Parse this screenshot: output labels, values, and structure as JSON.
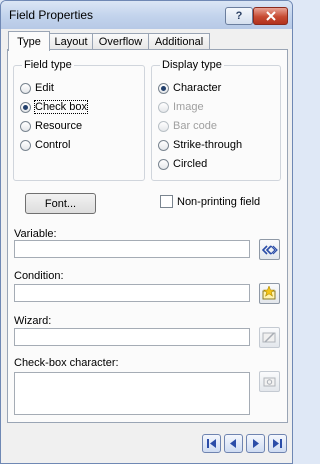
{
  "window": {
    "title": "Field Properties"
  },
  "tabs": [
    {
      "label": "Type",
      "active": true
    },
    {
      "label": "Layout",
      "active": false
    },
    {
      "label": "Overflow",
      "active": false
    },
    {
      "label": "Additional",
      "active": false
    }
  ],
  "field_type": {
    "title": "Field type",
    "options": [
      {
        "label": "Edit",
        "selected": false
      },
      {
        "label": "Check box",
        "selected": true
      },
      {
        "label": "Resource",
        "selected": false
      },
      {
        "label": "Control",
        "selected": false
      }
    ]
  },
  "display_type": {
    "title": "Display type",
    "options": [
      {
        "label": "Character",
        "selected": true,
        "enabled": true
      },
      {
        "label": "Image",
        "selected": false,
        "enabled": false
      },
      {
        "label": "Bar code",
        "selected": false,
        "enabled": false
      },
      {
        "label": "Strike-through",
        "selected": false,
        "enabled": true
      },
      {
        "label": "Circled",
        "selected": false,
        "enabled": true
      }
    ]
  },
  "font_button": {
    "label": "Font..."
  },
  "non_printing": {
    "label": "Non-printing field",
    "checked": false
  },
  "fields": {
    "variable": {
      "label": "Variable:",
      "value": ""
    },
    "condition": {
      "label": "Condition:",
      "value": ""
    },
    "wizard": {
      "label": "Wizard:",
      "value": ""
    },
    "checkbox_character": {
      "label": "Check-box character:",
      "value": ""
    }
  },
  "icons": {
    "insert_field": "double-chevron-icon",
    "condition": "condition-wizard-icon",
    "wizard": "wizard-icon",
    "char_picker": "character-picker-icon",
    "nav": [
      "first-record-icon",
      "previous-record-icon",
      "next-record-icon",
      "last-record-icon"
    ]
  },
  "colors": {
    "accent": "#2b4da8",
    "title_bar": "#c2d3ec",
    "close": "#c74a32"
  }
}
